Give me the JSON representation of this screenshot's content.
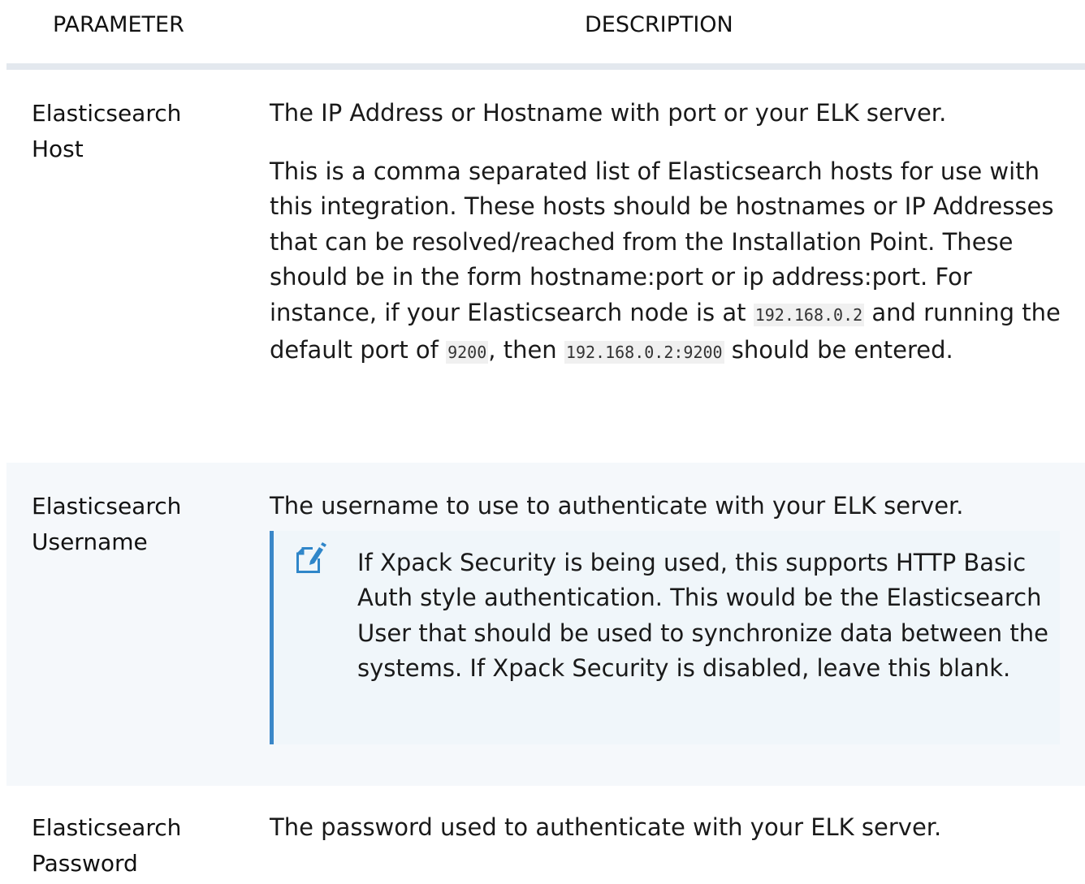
{
  "header": {
    "parameter": "PARAMETER",
    "description": "DESCRIPTION"
  },
  "rows": [
    {
      "param": "Elasticsearch Host",
      "desc1": "The IP Address or Hostname with port or your ELK server.",
      "desc2_a": "This is a comma separated list of Elasticsearch hosts for use with this integration. These hosts should be hostnames or IP Addresses that can be resolved/reached from the Installation Point. These should be in the form hostname:port or ip address:port. For instance, if your Elasticsearch node is at ",
      "code_ip": "192.168.0.2",
      "desc2_b": " and running the default port of ",
      "code_port": "9200",
      "desc2_c": ", then ",
      "code_full": "192.168.0.2:9200",
      "desc2_d": " should be entered."
    },
    {
      "param": "Elasticsearch Username",
      "desc1": "The username to use to authenticate with your ELK server.",
      "note": "If Xpack Security is being used, this supports HTTP Basic Auth style authentication. This would be the Elasticsearch User that should be used to synchronize data between the systems. If Xpack Security is disabled, leave this blank."
    },
    {
      "param": "Elasticsearch Password",
      "desc1": "The password used to authenticate with your ELK server."
    }
  ],
  "icons": {
    "note_icon": "note-pencil-icon"
  },
  "colors": {
    "header_border": "#e3e8ee",
    "alt_row_bg": "#f5f8fb",
    "note_bg": "#f0f6fa",
    "note_accent": "#3a87c8"
  }
}
